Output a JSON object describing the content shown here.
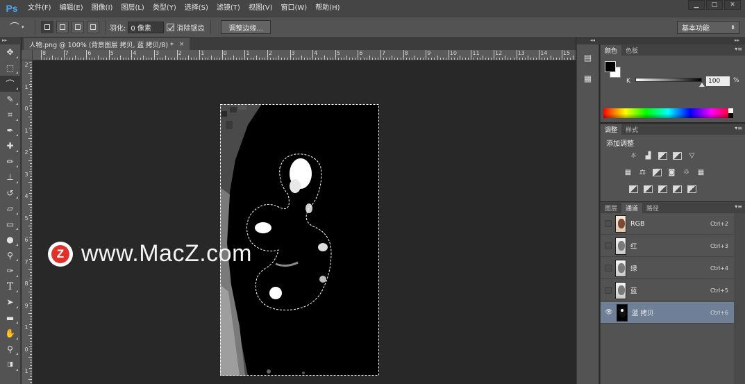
{
  "app": {
    "logo": "Ps",
    "menu": [
      "文件(F)",
      "编辑(E)",
      "图像(I)",
      "图层(L)",
      "类型(Y)",
      "选择(S)",
      "滤镜(T)",
      "视图(V)",
      "窗口(W)",
      "帮助(H)"
    ]
  },
  "options": {
    "feather_label": "羽化:",
    "feather_value": "0 像素",
    "antialias_label": "消除锯齿",
    "refine_edge": "调整边缘...",
    "workspace": "基本功能"
  },
  "document": {
    "tab_title": "人物.png @ 100% (背景图层 拷贝, 蓝 拷贝/8) *",
    "close": "×",
    "ruler_h": [
      "8",
      "7",
      "6",
      "5",
      "4",
      "3",
      "2",
      "1",
      "0",
      "1",
      "2",
      "3",
      "4",
      "5",
      "6",
      "7",
      "8",
      "9",
      "10",
      "11",
      "12",
      "13",
      "14",
      "15"
    ],
    "ruler_v": [
      "2",
      "1",
      "0",
      "1",
      "2",
      "3",
      "4",
      "5",
      "6",
      "7",
      "8",
      "9",
      "1",
      "0",
      "1"
    ]
  },
  "watermark": {
    "logo_letter": "Z",
    "text": "www.MacZ.com"
  },
  "color_panel": {
    "tabs": [
      "颜色",
      "色板"
    ],
    "channel_label": "K",
    "value": "100",
    "unit": "%",
    "foreground": "#000000",
    "background": "#ffffff"
  },
  "adjust_panel": {
    "tabs": [
      "调整",
      "样式"
    ],
    "title": "添加调整"
  },
  "channels_panel": {
    "tabs": [
      "图层",
      "通道",
      "路径"
    ],
    "rows": [
      {
        "name": "RGB",
        "shortcut": "Ctrl+2"
      },
      {
        "name": "红",
        "shortcut": "Ctrl+3"
      },
      {
        "name": "绿",
        "shortcut": "Ctrl+4"
      },
      {
        "name": "蓝",
        "shortcut": "Ctrl+5"
      },
      {
        "name": "蓝 拷贝",
        "shortcut": "Ctrl+6"
      }
    ]
  }
}
